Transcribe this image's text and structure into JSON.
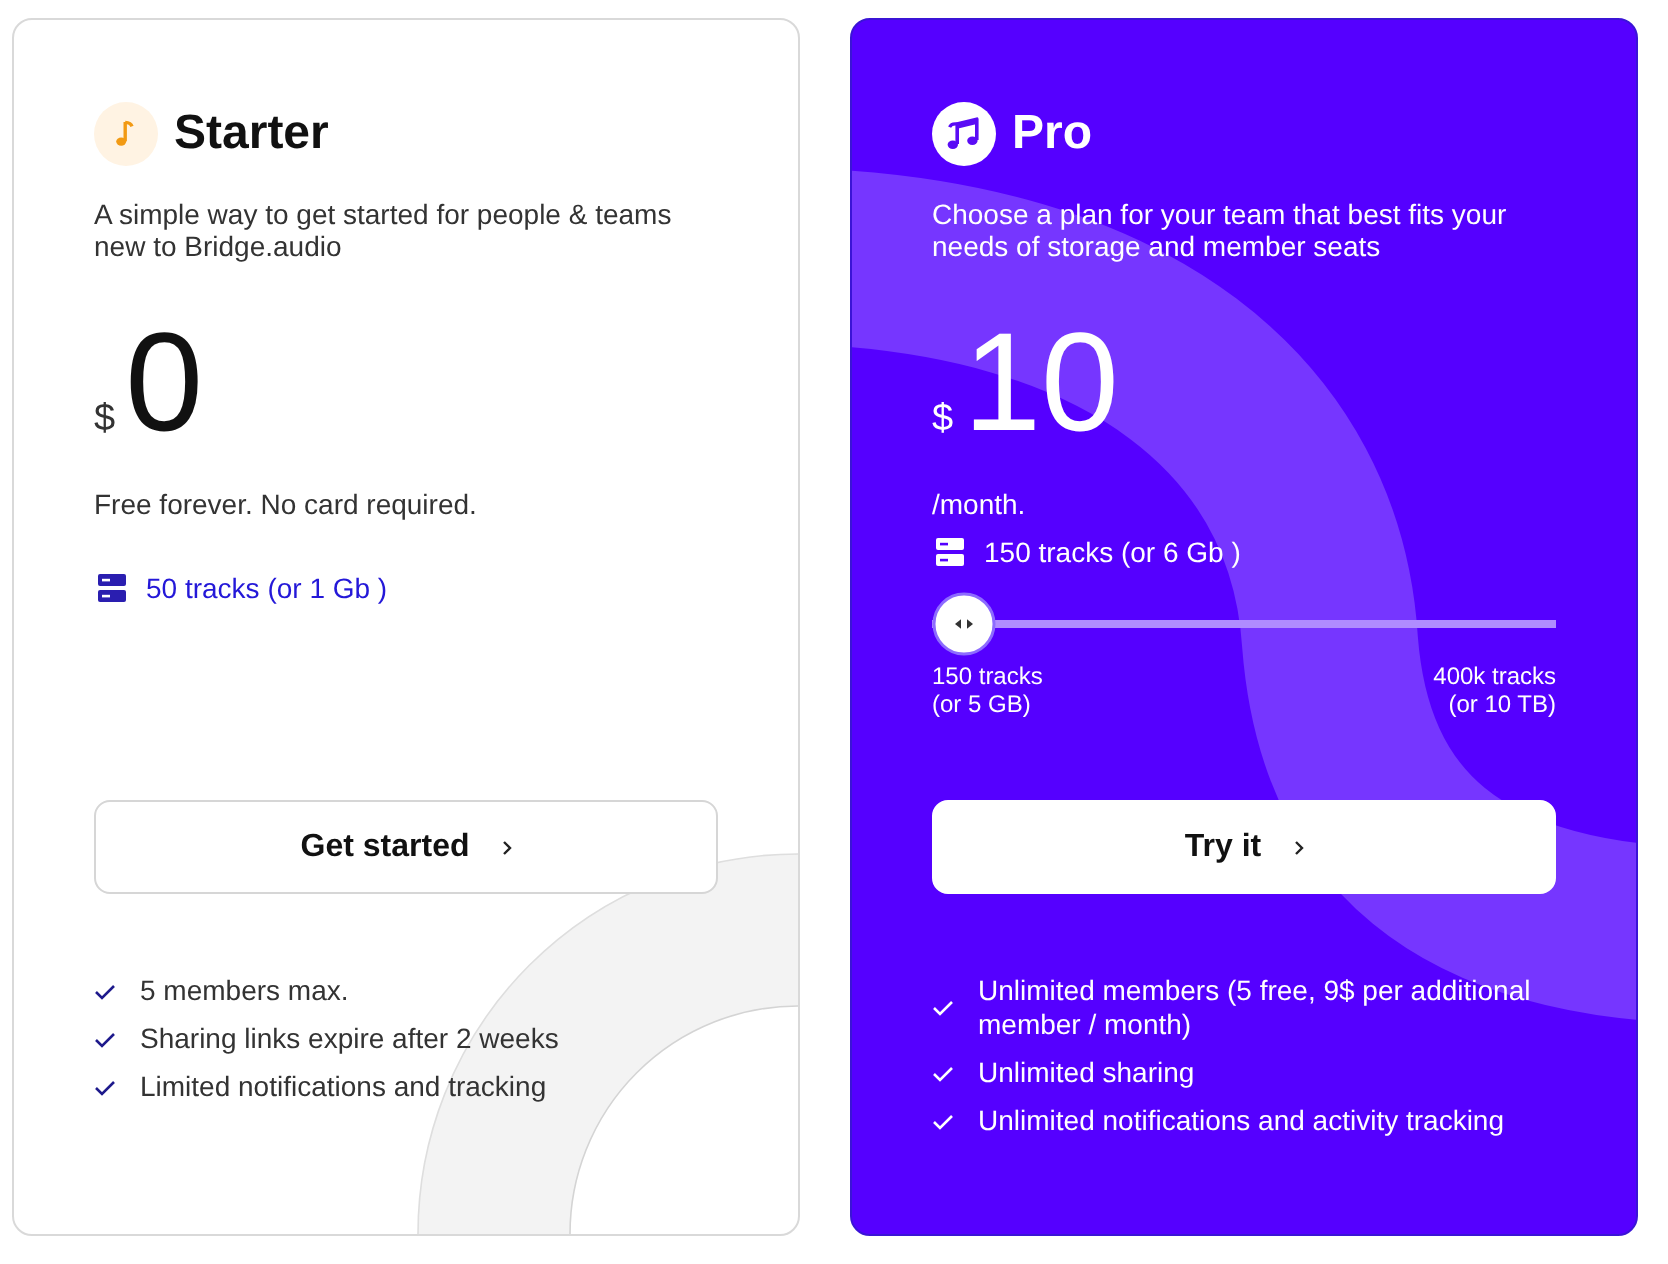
{
  "plans": [
    {
      "kind": "basic",
      "name": "Starter",
      "description": "A simple way to get started for people & teams new to Bridge.audio",
      "currency": "$",
      "price": "0",
      "note": "Free forever. No card required.",
      "storage": "50 tracks (or 1 Gb )",
      "button": "Get started",
      "features": [
        "5 members max.",
        "Sharing links expire after 2 weeks",
        "Limited notifications and tracking"
      ]
    },
    {
      "kind": "featured",
      "name": "Pro",
      "description": "Choose a plan for your team that best fits your needs of storage and member seats",
      "currency": "$",
      "price": "10",
      "period": "/month.",
      "storage": "150 tracks (or 6 Gb )",
      "slider": {
        "level": 0,
        "min_label": [
          "150 tracks",
          "(or 5 GB)"
        ],
        "max_label": [
          "400k tracks",
          "(or 10 TB)"
        ]
      },
      "button": "Try it",
      "features": [
        "Unlimited members (5 free, 9$ per additional member / month)",
        "Unlimited sharing",
        "Unlimited notifications and activity tracking"
      ]
    }
  ]
}
